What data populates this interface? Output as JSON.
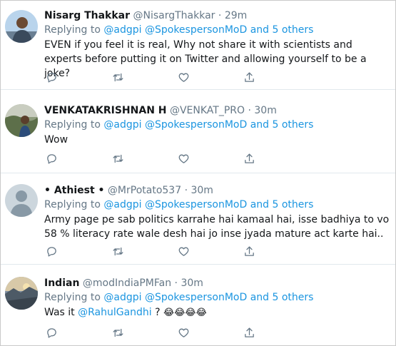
{
  "common": {
    "replying_prefix": "Replying to",
    "and_others": "and 5 others",
    "mention1": "@adgpi",
    "mention2": "@SpokespersonMoD"
  },
  "tweets": [
    {
      "name": "Nisarg Thakkar",
      "handle": "@NisargThakkar",
      "sep": "·",
      "time": "29m",
      "text": "EVEN if you feel it is real, Why not share it with scientists and experts before putting it on Twitter and allowing yourself to be a joke?"
    },
    {
      "name": "VENKATAKRISHNAN H",
      "handle": "@VENKAT_PRO",
      "sep": "·",
      "time": "30m",
      "text": "Wow"
    },
    {
      "name": "• Athiest •",
      "handle": "@MrPotato537",
      "sep": "·",
      "time": "30m",
      "text": "Army page pe sab politics karrahe hai kamaal hai, isse badhiya to vo 58 % literacy rate wale desh hai jo  inse jyada mature act karte hai.."
    },
    {
      "name": "Indian",
      "handle": "@modIndiaPMFan",
      "sep": "·",
      "time": "30m",
      "text_prefix": "Was it ",
      "text_mention": "@RahulGandhi",
      "text_suffix": " ? ",
      "emojis": "😂😂😂😂"
    }
  ],
  "icons": [
    "reply-icon",
    "retweet-icon",
    "like-icon",
    "share-icon"
  ],
  "colors": {
    "link": "#1b95e0",
    "secondary": "#657786",
    "text": "#14171a",
    "divider": "#e1e8ed"
  }
}
